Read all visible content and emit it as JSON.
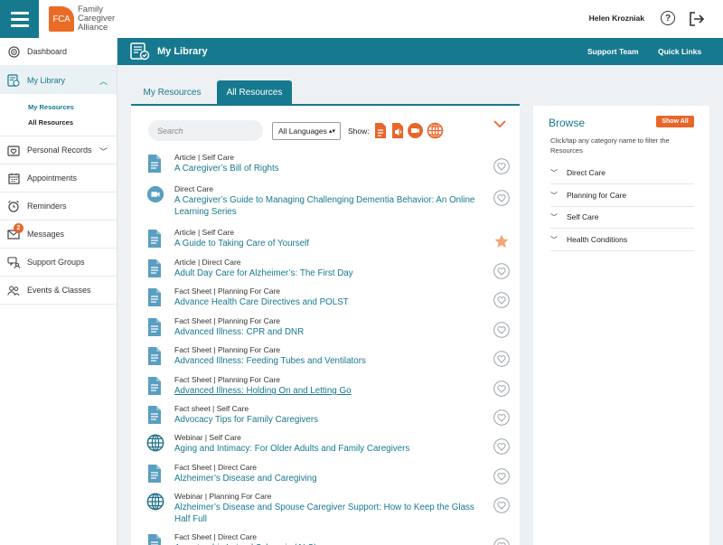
{
  "topbar": {
    "logo_short": "FCA",
    "logo_line1": "Family",
    "logo_line2": "Caregiver",
    "logo_line3": "Alliance",
    "user_name": "Helen Krozniak",
    "help_glyph": "?"
  },
  "sidebar": {
    "items": [
      {
        "label": "Dashboard",
        "icon": "dashboard-icon"
      },
      {
        "label": "My Library",
        "icon": "library-icon",
        "active": true
      },
      {
        "label": "Personal Records",
        "icon": "heart-folder-icon"
      },
      {
        "label": "Appointments",
        "icon": "calendar-icon"
      },
      {
        "label": "Reminders",
        "icon": "alarm-clock-icon"
      },
      {
        "label": "Messages",
        "icon": "envelope-icon",
        "badge": "2"
      },
      {
        "label": "Support Groups",
        "icon": "chat-group-icon"
      },
      {
        "label": "Events & Classes",
        "icon": "people-icon"
      }
    ],
    "sub_items": [
      "My Resources",
      "All Resources"
    ]
  },
  "banner": {
    "title": "My Library",
    "support_team": "Support Team",
    "quick_links": "Quick Links"
  },
  "tabs": {
    "my_resources": "My Resources",
    "all_resources": "All Resources"
  },
  "filters": {
    "search_placeholder": "Search",
    "language": "All Languages",
    "show_label": "Show:"
  },
  "resources": [
    {
      "meta": "Article | Self Care",
      "title": "A Caregiver’s Bill of Rights",
      "icon": "document-icon",
      "favorite": false
    },
    {
      "meta": "Direct Care",
      "title": "A Caregiver’s Guide to Managing Challenging Dementia Behavior: An Online Learning Series",
      "icon": "video-icon",
      "favorite": false
    },
    {
      "meta": "Article | Self Care",
      "title": "A Guide to Taking Care of Yourself",
      "icon": "document-icon",
      "favorite": true
    },
    {
      "meta": "Article | Direct Care",
      "title": "Adult Day Care for Alzheimer’s: The First Day",
      "icon": "document-icon",
      "favorite": false
    },
    {
      "meta": "Fact Sheet | Planning For Care",
      "title": "Advance Health Care Directives and POLST",
      "icon": "document-icon",
      "favorite": false
    },
    {
      "meta": "Fact Sheet | Planning For Care",
      "title": "Advanced Illness: CPR and DNR",
      "icon": "document-icon",
      "favorite": false
    },
    {
      "meta": "Fact Sheet | Planning For Care",
      "title": "Advanced Illness: Feeding Tubes and Ventilators",
      "icon": "document-icon",
      "favorite": false
    },
    {
      "meta": "Fact Sheet | Planning For Care",
      "title": "Advanced Illness: Holding On and Letting Go",
      "icon": "document-icon",
      "favorite": false,
      "hover": true
    },
    {
      "meta": "Fact sheet | Self Care",
      "title": "Advocacy Tips for Family Caregivers",
      "icon": "document-icon",
      "favorite": false
    },
    {
      "meta": "Webinar | Self Care",
      "title": "Aging and Intimacy: For Older Adults and Family Caregivers",
      "icon": "globe-icon",
      "favorite": false
    },
    {
      "meta": "Fact Sheet | Direct Care",
      "title": "Alzheimer’s Disease and Caregiving",
      "icon": "document-icon",
      "favorite": false
    },
    {
      "meta": "Webinar | Planning For Care",
      "title": "Alzheimer’s Disease and Spouse Caregiver Support: How to Keep the Glass Half Full",
      "icon": "globe-icon",
      "favorite": false
    },
    {
      "meta": "Fact Sheet | Direct Care",
      "title": "Amyotrophic Lateral Sclerosis (ALS)",
      "icon": "document-icon",
      "favorite": false
    }
  ],
  "browse": {
    "title": "Browse",
    "show_all": "Show All",
    "description": "Click/tap any category name to filter the Resources",
    "categories": [
      "Direct Care",
      "Planning for Care",
      "Self Care",
      "Health Conditions"
    ]
  },
  "colors": {
    "teal": "#17798f",
    "orange": "#e8662a",
    "doc_blue": "#4a8fb0"
  }
}
